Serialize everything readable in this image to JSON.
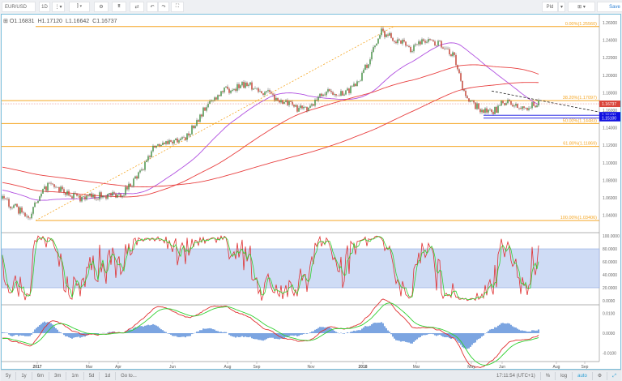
{
  "toolbar": {
    "symbol": "EUR/USD",
    "interval": "1D",
    "chart_type_icon": "candles-icon",
    "settings_icon": "gear-icon",
    "indicators_icon": "indicators-icon",
    "compare_icon": "compare-icon",
    "undo_icon": "undo-icon",
    "redo_icon": "redo-icon",
    "fullscreen_icon": "fullscreen-icon",
    "drawing_mode": "Pld",
    "layout_icon": "layout-grid-icon",
    "save_label": "Save"
  },
  "ohlc": {
    "open": "O1.16831",
    "high": "H1.17120",
    "low": "L1.16642",
    "close": "C1.16737"
  },
  "fib_levels": [
    {
      "label": "0.00%(1.25560)",
      "price": 1.2556
    },
    {
      "label": "38.20%(1.17097)",
      "price": 1.17097
    },
    {
      "label": "50.00%(1.14483)",
      "price": 1.14483
    },
    {
      "label": "61.80%(1.11869)",
      "price": 1.11869
    },
    {
      "label": "100.00%(1.03406)",
      "price": 1.03406
    }
  ],
  "price_axis": [
    "1.26000",
    "1.24000",
    "1.22000",
    "1.20000",
    "1.18000",
    "1.16000",
    "1.14000",
    "1.12000",
    "1.10000",
    "1.08000",
    "1.06000",
    "1.04000"
  ],
  "price_labels": {
    "current": "1.16737",
    "support1": "1.15431",
    "support2": "1.15100"
  },
  "stoch_axis": [
    "100.0000",
    "80.0000",
    "60.0000",
    "40.0000",
    "20.0000",
    "0.0000"
  ],
  "macd_axis": [
    "0.0100",
    "0.0000",
    "-0.0100"
  ],
  "time_axis": [
    "2017",
    "Mar",
    "Apr",
    "Jun",
    "Aug",
    "Sep",
    "Nov",
    "2018",
    "Mar",
    "May",
    "Jun",
    "Aug",
    "Sep"
  ],
  "bottom": {
    "ranges": [
      "5y",
      "1y",
      "6m",
      "3m",
      "1m",
      "5d",
      "1d"
    ],
    "goto": "Go to...",
    "time": "17:11:54 (UTC+1)",
    "percent": "%",
    "log": "log",
    "auto": "auto"
  },
  "colors": {
    "up": "#3b8a3b",
    "down": "#c0392b",
    "fib": "#f5a623",
    "ma_fast": "#b04fe0",
    "ma_slow": "#e84040",
    "blue_line": "#1010e0",
    "stoch_band": "#cfdcf5"
  },
  "chart_data": {
    "type": "candlestick",
    "price_path": [
      [
        0,
        1.059
      ],
      [
        16,
        1.038
      ],
      [
        28,
        1.075
      ],
      [
        48,
        1.06
      ],
      [
        74,
        1.065
      ],
      [
        86,
        1.09
      ],
      [
        94,
        1.12
      ],
      [
        114,
        1.13
      ],
      [
        124,
        1.16
      ],
      [
        134,
        1.18
      ],
      [
        149,
        1.19
      ],
      [
        164,
        1.18
      ],
      [
        172,
        1.17
      ],
      [
        186,
        1.16
      ],
      [
        199,
        1.18
      ],
      [
        212,
        1.18
      ],
      [
        222,
        1.2
      ],
      [
        234,
        1.25
      ],
      [
        244,
        1.24
      ],
      [
        252,
        1.23
      ],
      [
        259,
        1.24
      ],
      [
        272,
        1.235
      ],
      [
        279,
        1.22
      ],
      [
        287,
        1.17
      ],
      [
        297,
        1.16
      ],
      [
        302,
        1.156
      ],
      [
        310,
        1.17
      ],
      [
        320,
        1.162
      ],
      [
        331,
        1.167
      ]
    ],
    "ylim": [
      1.03,
      1.265
    ]
  }
}
